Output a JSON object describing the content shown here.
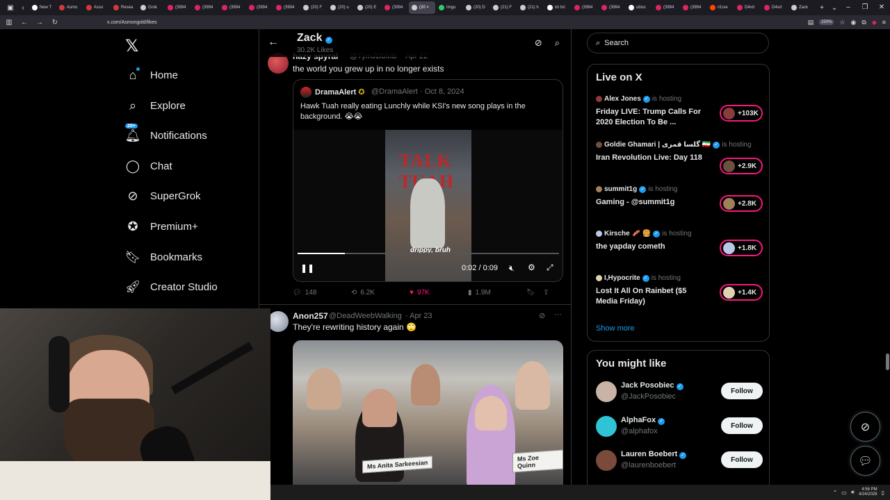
{
  "browser": {
    "tabs": [
      {
        "label": "New T",
        "color": "#ffffff"
      },
      {
        "label": "Asmo",
        "color": "#d23a3a"
      },
      {
        "label": "Asso",
        "color": "#d23a3a"
      },
      {
        "label": "Resea",
        "color": "#d23a3a"
      },
      {
        "label": "Grok",
        "color": "#cccccc"
      },
      {
        "label": "(3994",
        "color": "#e0245e"
      },
      {
        "label": "(3994",
        "color": "#e0245e"
      },
      {
        "label": "(3994",
        "color": "#e0245e"
      },
      {
        "label": "(3994",
        "color": "#e0245e"
      },
      {
        "label": "(3994",
        "color": "#e0245e"
      },
      {
        "label": "(20) F",
        "color": "#cccccc"
      },
      {
        "label": "(20) u",
        "color": "#cccccc"
      },
      {
        "label": "(20) E",
        "color": "#cccccc"
      },
      {
        "label": "(3994",
        "color": "#e0245e"
      },
      {
        "label": "(20 ×",
        "color": "#cccccc",
        "active": true
      },
      {
        "label": "Imgu",
        "color": "#2ecc71"
      },
      {
        "label": "(20) D",
        "color": "#cccccc"
      },
      {
        "label": "(21) F",
        "color": "#cccccc"
      },
      {
        "label": "(21) h",
        "color": "#cccccc"
      },
      {
        "label": "im bri",
        "color": "#ffffff"
      },
      {
        "label": "(3994",
        "color": "#e0245e"
      },
      {
        "label": "(3994",
        "color": "#e0245e"
      },
      {
        "label": "ubisc",
        "color": "#ffffff"
      },
      {
        "label": "(3994",
        "color": "#e0245e"
      },
      {
        "label": "(3994",
        "color": "#e0245e"
      },
      {
        "label": "r/Live",
        "color": "#ff4500"
      },
      {
        "label": "D4vd",
        "color": "#e0245e"
      },
      {
        "label": "D4vd",
        "color": "#e0245e"
      },
      {
        "label": "Zack",
        "color": "#cccccc"
      }
    ],
    "url": "x.com/Asmongold/likes",
    "zoom": "150%"
  },
  "nav": {
    "items": [
      {
        "label": "Home",
        "icon": "home-icon"
      },
      {
        "label": "Explore",
        "icon": "search-icon"
      },
      {
        "label": "Notifications",
        "icon": "bell-icon",
        "badge": "20+"
      },
      {
        "label": "Chat",
        "icon": "chat-icon"
      },
      {
        "label": "SuperGrok",
        "icon": "grok-icon"
      },
      {
        "label": "Premium+",
        "icon": "premium-icon"
      },
      {
        "label": "Bookmarks",
        "icon": "bookmark-icon"
      },
      {
        "label": "Creator Studio",
        "icon": "rocket-icon"
      }
    ]
  },
  "profile": {
    "name": "Zack",
    "likes": "30.2K Likes"
  },
  "tweets": [
    {
      "author": "hazy spyral",
      "handle": "@TymJDbMB",
      "date": "Apr 22",
      "text": "the world you grew up in no longer exists",
      "quote": {
        "author": "DramaAlert",
        "handle": "@DramaAlert",
        "date": "Oct 8, 2024",
        "text": "Hawk Tuah really eating Lunchly while KSI's new song plays in the background. 😭😭",
        "video": {
          "sign": "TALK TUAH",
          "caption": "drippy, bruh",
          "time": "0:02 / 0:09",
          "progress": 0.18
        }
      },
      "stats": {
        "replies": "148",
        "reposts": "6.2K",
        "likes": "97K",
        "views": "1.9M"
      }
    },
    {
      "author": "Anon257",
      "handle": "@DeadWeebWalking",
      "date": "Apr 23",
      "text": "They're rewriting history again 🙄",
      "photo": {
        "left_plate": "Ms Anita Sarkeesian",
        "right_plate": "Ms Zoe Quinn"
      }
    }
  ],
  "search": {
    "placeholder": "Search"
  },
  "live": {
    "heading": "Live on X",
    "hosting": "is hosting",
    "items": [
      {
        "host": "Alex Jones",
        "title": "Friday LIVE: Trump Calls For 2020 Election To Be ...",
        "count": "+103K"
      },
      {
        "host": "Goldie Ghamari | گلسا قمری 🇮🇷",
        "title": "Iran Revolution Live: Day 118",
        "count": "+2.9K"
      },
      {
        "host": "summit1g",
        "title": "Gaming - @summit1g",
        "count": "+2.8K"
      },
      {
        "host": "Kirsche 🥓 🍔",
        "title": "the yapday cometh",
        "count": "+1.8K"
      },
      {
        "host": "I,Hypocrite",
        "title": "Lost It All On Rainbet ($5 Media Friday)",
        "count": "+1.4K"
      }
    ],
    "show_more": "Show more"
  },
  "suggestions": {
    "heading": "You might like",
    "follow": "Follow",
    "items": [
      {
        "name": "Jack Posobiec",
        "handle": "@JackPosobiec"
      },
      {
        "name": "AlphaFox",
        "handle": "@alphafox"
      },
      {
        "name": "Lauren Boebert",
        "handle": "@laurenboebert"
      }
    ]
  },
  "taskbar": {
    "time": "4:56 PM",
    "date": "4/24/2026"
  }
}
